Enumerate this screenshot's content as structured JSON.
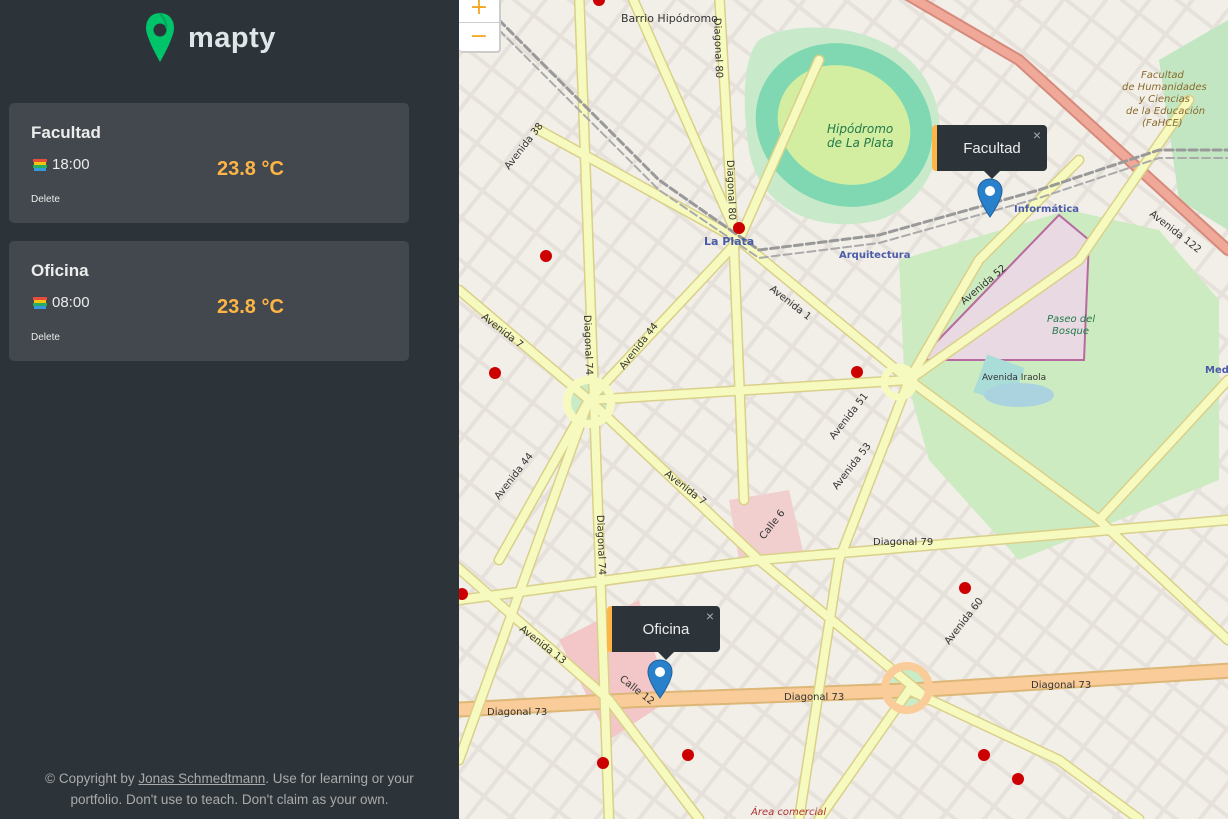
{
  "app": {
    "name": "mapty"
  },
  "workouts": [
    {
      "title": "Facultad",
      "time": "18:00",
      "temp": "23.8 °C",
      "delete": "Delete"
    },
    {
      "title": "Oficina",
      "time": "08:00",
      "temp": "23.8 °C",
      "delete": "Delete"
    }
  ],
  "footer": {
    "prefix": "© Copyright by ",
    "author": "Jonas Schmedtmann",
    "suffix": ". Use for learning or your portfolio. Don't use to teach. Don't claim as your own."
  },
  "map": {
    "zoom_in": "+",
    "zoom_out": "−",
    "popups": [
      {
        "label": "Facultad",
        "close": "×"
      },
      {
        "label": "Oficina",
        "close": "×"
      }
    ],
    "labels": {
      "barrio": "Barrio Hipódromo",
      "hipodromo_1": "Hipódromo",
      "hipodromo_2": "de La Plata",
      "laplata": "La Plata",
      "arquitectura": "Arquitectura",
      "informatica": "Informática",
      "fahce_1": "Facultad",
      "fahce_2": "de Humanidades",
      "fahce_3": "y Ciencias",
      "fahce_4": "de la Educación",
      "fahce_5": "(FaHCE)",
      "paseo_1": "Paseo del",
      "paseo_2": "Bosque",
      "diag73_a": "Diagonal 73",
      "diag73_b": "Diagonal 73",
      "diag73_c": "Diagonal 73",
      "diag79": "Diagonal 79",
      "diag74_a": "Diagonal 74",
      "diag74_b": "Diagonal 74",
      "diag80_a": "Diagonal 80",
      "diag80_b": "Diagonal 80",
      "av7": "Avenida 7",
      "av7b": "Avenida 7",
      "av13": "Avenida 13",
      "av44": "Avenida 44",
      "av44b": "Avenida 44",
      "av38": "Avenida 38",
      "av51": "Avenida 51",
      "av53": "Avenida 53",
      "av60": "Avenida 60",
      "av122": "Avenida 122",
      "av1": "Avenida 1",
      "av52": "Avenida 52",
      "iraola": "Avenida Iraola",
      "calle6": "Calle 6",
      "calle12": "Calle 12",
      "area": "Área comercial",
      "medi": "Medi"
    }
  }
}
